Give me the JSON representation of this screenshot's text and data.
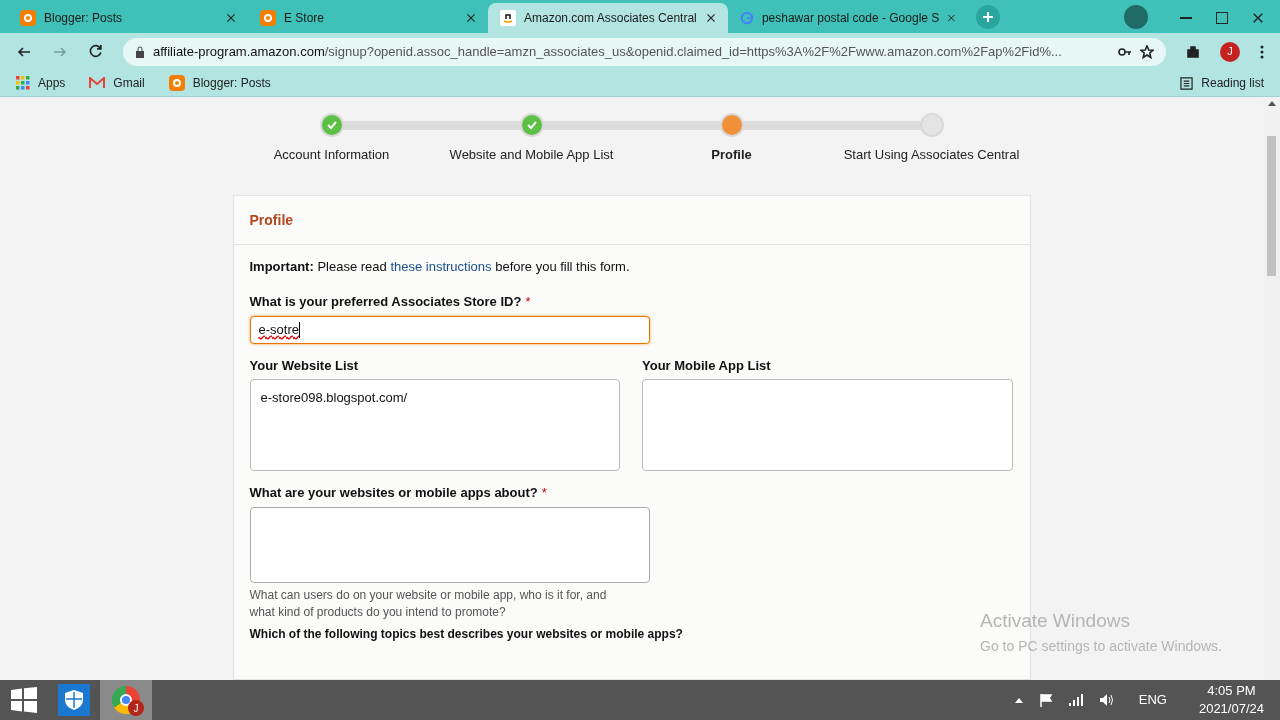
{
  "browser": {
    "tabs": [
      {
        "title": "Blogger: Posts",
        "selected": false
      },
      {
        "title": "E Store",
        "selected": false
      },
      {
        "title": "Amazon.com Associates Central",
        "selected": true
      },
      {
        "title": "peshawar postal code - Google S",
        "selected": false
      }
    ],
    "url_host": "affiliate-program.amazon.com",
    "url_path": "/signup?openid.assoc_handle=amzn_associates_us&openid.claimed_id=https%3A%2F%2Fwww.amazon.com%2Fap%2Fid%...",
    "profile_initial": "J",
    "bookmarks": [
      {
        "label": "Apps"
      },
      {
        "label": "Gmail"
      },
      {
        "label": "Blogger: Posts"
      }
    ],
    "reading_list": "Reading list"
  },
  "steps": [
    {
      "label": "Account Information",
      "done": true,
      "selected": false
    },
    {
      "label": "Website and Mobile App List",
      "done": true,
      "selected": false
    },
    {
      "label": "Profile",
      "done": false,
      "selected": true
    },
    {
      "label": "Start Using Associates Central",
      "done": false,
      "selected": false
    }
  ],
  "form": {
    "title": "Profile",
    "notice": "**Important:** Please read ",
    "notice_link": "these instructions",
    "notice_tail": " before you fill this form.",
    "store_id": {
      "label": "What is your preferred Associates Store ID?",
      "required_mark": "*",
      "value": "e-sotre",
      "focused": true
    },
    "website_list": {
      "label": "Your Website List",
      "value": "e-store098.blogspot.com/"
    },
    "app_list": {
      "label": "Your Mobile App List"
    },
    "about": {
      "label": "What are your websites or mobile apps about?",
      "required_mark": "*",
      "hint": "What can users do on your website or mobile app, who is it for, and what kind of products do you intend to promote?"
    },
    "next_label": "Which of the following topics best describes your websites or mobile apps?"
  },
  "activation": {
    "title": "Activate Windows",
    "subtitle": "Go to PC settings to activate Windows."
  },
  "taskbar": {
    "language": "ENG",
    "time": "4:05 PM",
    "date": "2021/07/24",
    "chrome_badge": "J"
  }
}
